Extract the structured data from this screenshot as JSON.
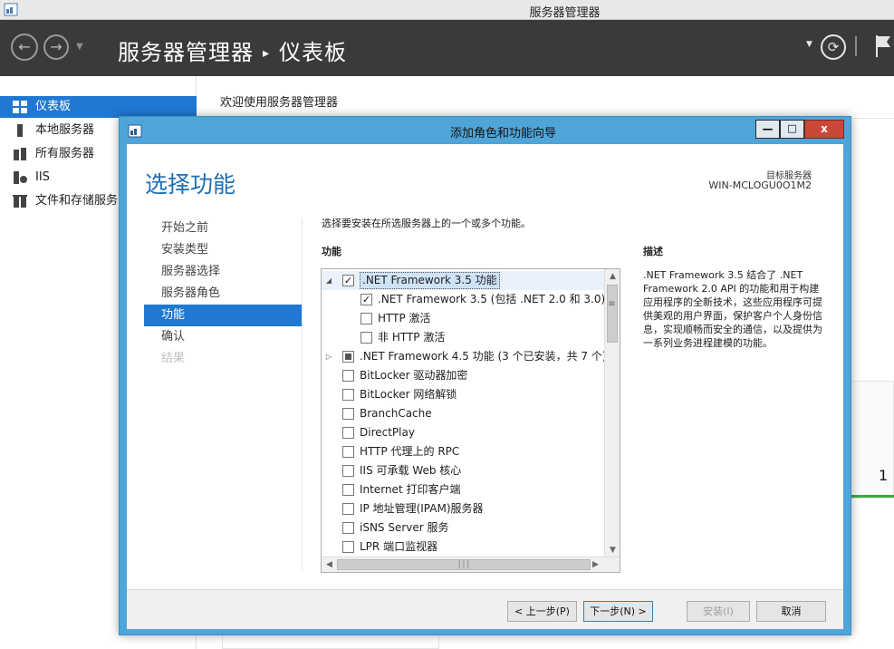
{
  "window": {
    "title": "服务器管理器"
  },
  "header": {
    "breadcrumb_root": "服务器管理器",
    "breadcrumb_sep": "▸",
    "breadcrumb_current": "仪表板"
  },
  "sidebar": {
    "items": [
      {
        "label": "仪表板",
        "icon": "dashboard-icon",
        "active": true
      },
      {
        "label": "本地服务器",
        "icon": "server-icon"
      },
      {
        "label": "所有服务器",
        "icon": "servers-icon"
      },
      {
        "label": "IIS",
        "icon": "iis-icon"
      },
      {
        "label": "文件和存储服务",
        "icon": "storage-icon"
      }
    ]
  },
  "content": {
    "welcome": "欢迎使用服务器管理器",
    "tile_count": "1"
  },
  "wizard": {
    "title": "添加角色和功能向导",
    "heading": "选择功能",
    "target_label": "目标服务器",
    "target_value": "WIN-MCLOGU0O1M2",
    "steps": [
      {
        "label": "开始之前",
        "state": "normal"
      },
      {
        "label": "安装类型",
        "state": "normal"
      },
      {
        "label": "服务器选择",
        "state": "normal"
      },
      {
        "label": "服务器角色",
        "state": "normal"
      },
      {
        "label": "功能",
        "state": "active"
      },
      {
        "label": "确认",
        "state": "normal"
      },
      {
        "label": "结果",
        "state": "disabled"
      }
    ],
    "instruction": "选择要安装在所选服务器上的一个或多个功能。",
    "features_label": "功能",
    "description_label": "描述",
    "description_text": ".NET Framework 3.5 结合了 .NET Framework 2.0 API 的功能和用于构建应用程序的全新技术，这些应用程序可提供美观的用户界面，保护客户个人身份信息，实现顺畅而安全的通信，以及提供为一系列业务进程建模的功能。",
    "features": [
      {
        "label": ".NET Framework 3.5 功能",
        "level": 0,
        "expander": "expanded",
        "check": "checked",
        "selected": true
      },
      {
        "label": ".NET Framework 3.5 (包括 .NET 2.0 和 3.0)",
        "level": 1,
        "check": "checked"
      },
      {
        "label": "HTTP 激活",
        "level": 1,
        "check": "unchecked"
      },
      {
        "label": "非 HTTP 激活",
        "level": 1,
        "check": "unchecked"
      },
      {
        "label": ".NET Framework 4.5 功能 (3 个已安装，共 7 个)",
        "level": 0,
        "expander": "collapsed",
        "check": "partial"
      },
      {
        "label": "BitLocker 驱动器加密",
        "level": 0,
        "check": "unchecked"
      },
      {
        "label": "BitLocker 网络解锁",
        "level": 0,
        "check": "unchecked"
      },
      {
        "label": "BranchCache",
        "level": 0,
        "check": "unchecked"
      },
      {
        "label": "DirectPlay",
        "level": 0,
        "check": "unchecked"
      },
      {
        "label": "HTTP 代理上的 RPC",
        "level": 0,
        "check": "unchecked"
      },
      {
        "label": "IIS 可承载 Web 核心",
        "level": 0,
        "check": "unchecked"
      },
      {
        "label": "Internet 打印客户端",
        "level": 0,
        "check": "unchecked"
      },
      {
        "label": "IP 地址管理(IPAM)服务器",
        "level": 0,
        "check": "unchecked"
      },
      {
        "label": "iSNS Server 服务",
        "level": 0,
        "check": "unchecked"
      },
      {
        "label": "LPR 端口监视器",
        "level": 0,
        "check": "unchecked"
      }
    ],
    "buttons": {
      "prev": "< 上一步(P)",
      "next": "下一步(N) >",
      "install": "安装(I)",
      "cancel": "取消"
    }
  },
  "colors": {
    "accent": "#1f78d1",
    "header_bg": "#3a3a3a",
    "wizard_frame": "#4fa5d8",
    "heading": "#1c6fb5"
  }
}
